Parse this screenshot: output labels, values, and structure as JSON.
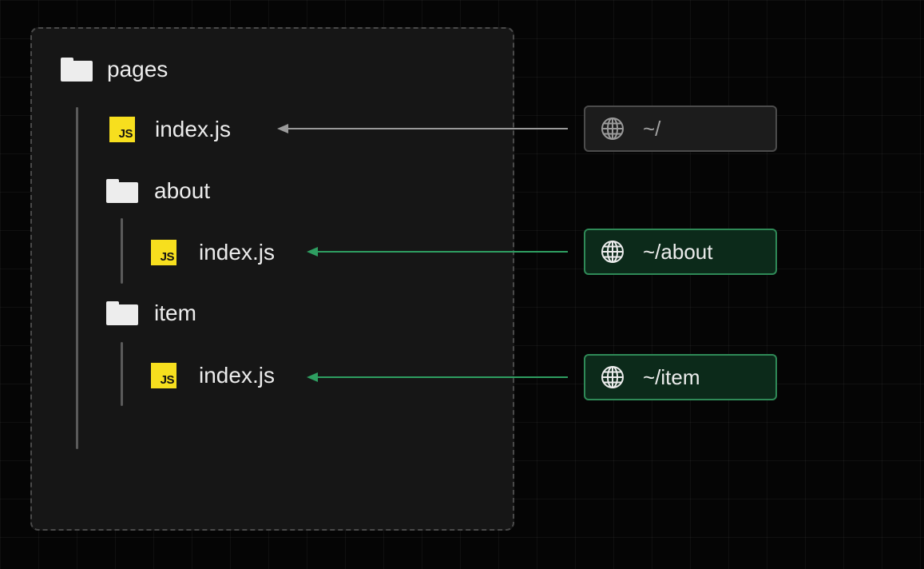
{
  "tree": {
    "root_folder": "pages",
    "root_file": "index.js",
    "about_folder": "about",
    "about_file": "index.js",
    "item_folder": "item",
    "item_file": "index.js",
    "file_icon_text": "JS"
  },
  "routes": {
    "root": "~/",
    "about": "~/about",
    "item": "~/item"
  },
  "colors": {
    "js_badge": "#f7df1e",
    "active_route_border": "#2f8a57",
    "active_route_fill": "#0c2a1a",
    "active_arrow": "#2e9e61",
    "neutral_arrow": "#9a9a9a"
  },
  "icons": {
    "folder": "folder-icon",
    "file": "javascript-file-icon",
    "route": "globe-icon"
  }
}
